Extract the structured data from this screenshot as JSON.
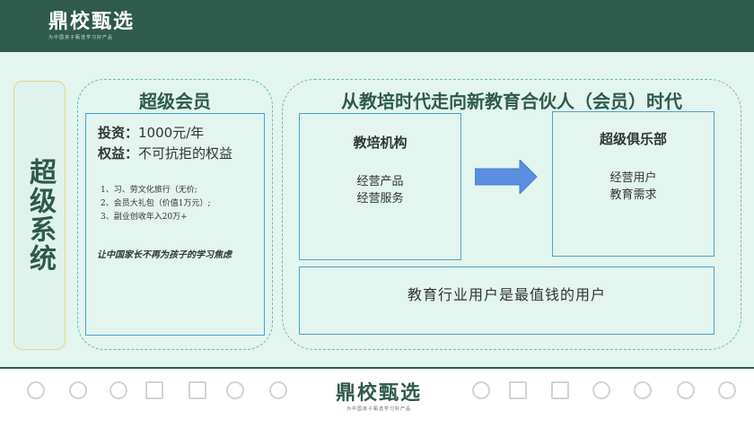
{
  "header": {
    "logo_title": "鼎校甄选",
    "logo_subtitle": "为中国孩子甄选学习好产品"
  },
  "side": {
    "title": "超级系统"
  },
  "member": {
    "title": "超级会员",
    "investment_label": "投资：",
    "investment_value": "1000元/年",
    "rights_label": "权益：",
    "rights_value": "不可抗拒的权益",
    "benefits": [
      "1、习、劳文化旅行（无价;",
      "2、会员大礼包（价值1万元）;",
      "3、副业创收年入20万+"
    ],
    "slogan": "让中国家长不再为孩子的学习焦虑"
  },
  "era": {
    "title": "从教培时代走向新教育合伙人（会员）时代",
    "left_box": {
      "title": "教培机构",
      "lines": [
        "经营产品",
        "经营服务"
      ]
    },
    "right_box": {
      "title": "超级俱乐部",
      "lines": [
        "经营用户",
        "教育需求"
      ]
    },
    "bottom_text": "教育行业用户是最值钱的用户",
    "arrow_color": "#5b8ee0"
  },
  "footer": {
    "logo_title": "鼎校甄选",
    "logo_subtitle": "为中国孩子甄选学习好产品",
    "icons": [
      "medal-icon",
      "lightbulb-icon",
      "magnifier-icon",
      "ruler-icon",
      "book-icon",
      "magnifier-icon",
      "lightbulb-icon",
      "magnifier-icon",
      "ruler-icon",
      "book-icon",
      "globe-icon",
      "lightbulb-icon",
      "gears-icon",
      "medal-icon"
    ]
  },
  "colors": {
    "brand_green": "#2e5b4b",
    "background_mint": "#e2f5ee",
    "box_border_blue": "#48a3cf",
    "dashed_border_green": "#6bc09a"
  }
}
